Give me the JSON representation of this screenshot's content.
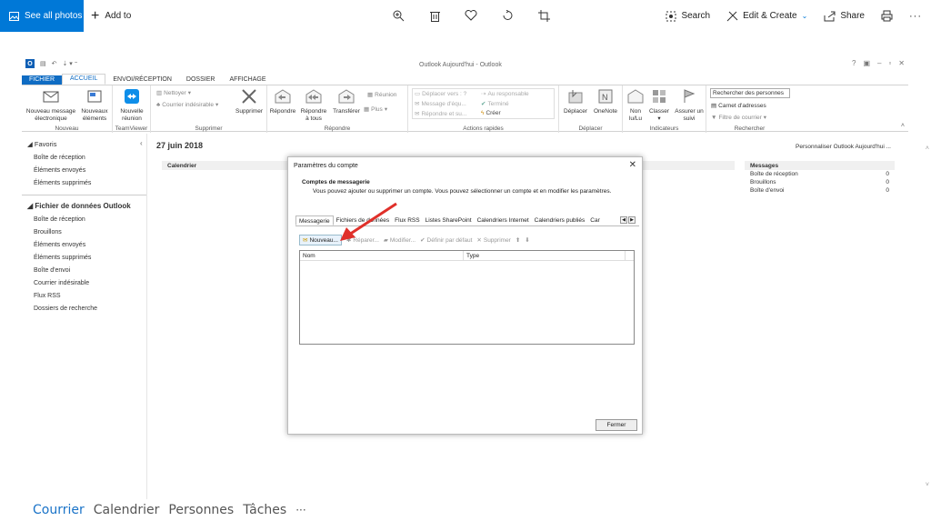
{
  "photos_bar": {
    "see_all": "See all photos",
    "add_to": "Add to",
    "search": "Search",
    "edit_create": "Edit & Create",
    "share": "Share"
  },
  "window": {
    "title": "Outlook Aujourd'hui - Outlook"
  },
  "tabs": [
    "FICHIER",
    "ACCUEIL",
    "ENVOI/RÉCEPTION",
    "DOSSIER",
    "AFFICHAGE"
  ],
  "ribbon": {
    "nouveau_message_1": "Nouveau message",
    "nouveau_message_2": "électronique",
    "nouveaux_1": "Nouveaux",
    "nouveaux_2": "éléments",
    "nouvelle_1": "Nouvelle",
    "nouvelle_2": "réunion",
    "grp_nouveau": "Nouveau",
    "grp_teamviewer": "TeamViewer",
    "nettoyer": "Nettoyer",
    "courrier_indesirable": "Courrier indésirable",
    "supprimer": "Supprimer",
    "grp_supprimer": "Supprimer",
    "repondre": "Répondre",
    "repondre_tous_1": "Répondre",
    "repondre_tous_2": "à tous",
    "transferer": "Transférer",
    "reunion": "Réunion",
    "plus": "Plus",
    "grp_repondre": "Répondre",
    "deplacer_vers": "Déplacer vers : ?",
    "au_responsable": "Au responsable",
    "message_equipe": "Message d'équ...",
    "termine": "Terminé",
    "repondre_su": "Répondre et su...",
    "creer": "Créer",
    "grp_actions": "Actions rapides",
    "deplacer": "Déplacer",
    "onenote": "OneNote",
    "grp_deplacer": "Déplacer",
    "non_lu_1": "Non",
    "non_lu_2": "lu/Lu",
    "classer": "Classer",
    "assurer_1": "Assurer un",
    "assurer_2": "suivi",
    "grp_indicateurs": "Indicateurs",
    "rechercher_personnes": "Rechercher des personnes",
    "carnet": "Carnet d'adresses",
    "filtre": "Filtre de courrier",
    "grp_rechercher": "Rechercher"
  },
  "nav": {
    "favoris": "Favoris",
    "fav_items": [
      "Boîte de réception",
      "Éléments envoyés",
      "Éléments supprimés"
    ],
    "data_file": "Fichier de données Outlook",
    "data_items": [
      "Boîte de réception",
      "Brouillons",
      "Éléments envoyés",
      "Éléments supprimés",
      "Boîte d'envoi",
      "Courrier indésirable",
      "Flux RSS",
      "Dossiers de recherche"
    ]
  },
  "main": {
    "date": "27 juin 2018",
    "personalize": "Personnaliser Outlook Aujourd'hui ...",
    "calendrier": "Calendrier",
    "messages": "Messages",
    "msg_rows": [
      {
        "label": "Boîte de réception",
        "count": "0"
      },
      {
        "label": "Brouillons",
        "count": "0"
      },
      {
        "label": "Boîte d'envoi",
        "count": "0"
      }
    ]
  },
  "dialog": {
    "title": "Paramètres du compte",
    "heading": "Comptes de messagerie",
    "subtitle": "Vous pouvez ajouter ou supprimer un compte. Vous pouvez sélectionner un compte et en modifier les paramètres.",
    "tabs": [
      "Messagerie",
      "Fichiers de données",
      "Flux RSS",
      "Listes SharePoint",
      "Calendriers Internet",
      "Calendriers publiés",
      "Car"
    ],
    "tools": {
      "nouveau": "Nouveau...",
      "reparer": "Réparer...",
      "modifier": "Modifier...",
      "definir": "Définir par défaut",
      "supprimer": "Supprimer"
    },
    "col_nom": "Nom",
    "col_type": "Type",
    "fermer": "Fermer"
  },
  "bottom_nav": [
    "Courrier",
    "Calendrier",
    "Personnes",
    "Tâches",
    "···"
  ],
  "colors": {
    "accent": "#0078d7",
    "outlook_blue": "#0f6cc3",
    "arrow": "#e0302a"
  }
}
